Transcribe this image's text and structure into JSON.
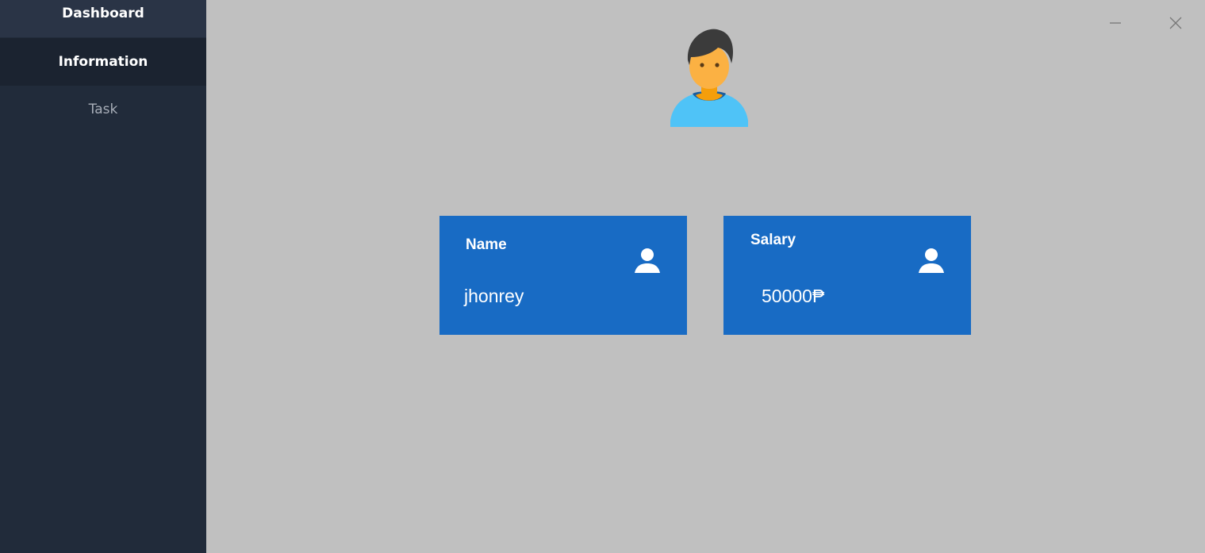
{
  "sidebar": {
    "items": [
      {
        "label": "Dashboard"
      },
      {
        "label": "Information"
      },
      {
        "label": "Task"
      }
    ]
  },
  "cards": {
    "name": {
      "title": "Name",
      "value": "jhonrey",
      "icon": "user-icon"
    },
    "salary": {
      "title": "Salary",
      "value": "50000₱",
      "icon": "user-icon"
    }
  },
  "colors": {
    "sidebar_bg": "#212b3a",
    "content_bg": "#c0c0c0",
    "card_bg": "#186bc4"
  }
}
